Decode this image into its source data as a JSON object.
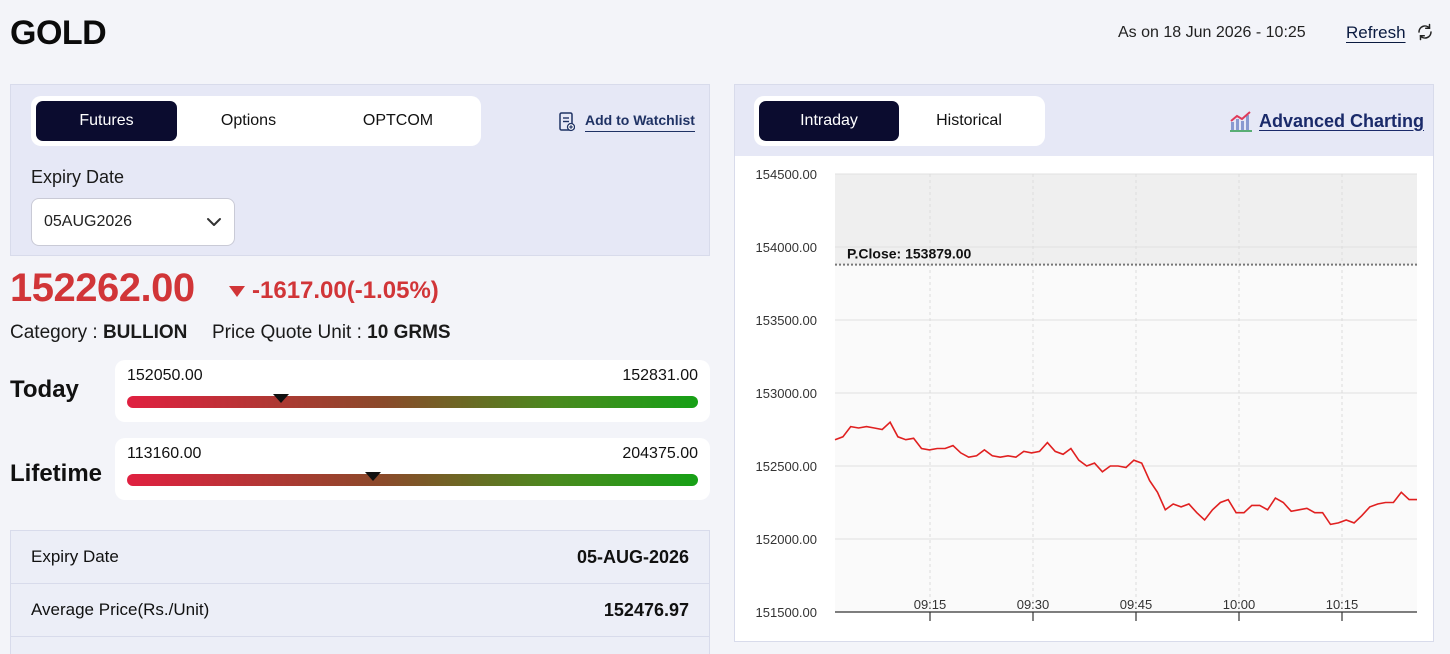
{
  "header": {
    "title": "GOLD",
    "as_on": "As on 18 Jun 2026 - 10:25",
    "refresh_label": "Refresh"
  },
  "left": {
    "tabs": [
      {
        "label": "Futures",
        "active": true
      },
      {
        "label": "Options",
        "active": false
      },
      {
        "label": "OPTCOM",
        "active": false
      }
    ],
    "watchlist_label": "Add to Watchlist",
    "expiry_label": "Expiry Date",
    "expiry_value": "05AUG2026",
    "price": "152262.00",
    "change": "-1617.00(-1.05%)",
    "category_label": "Category : ",
    "category_value": "BULLION",
    "pqu_label": "Price Quote Unit : ",
    "pqu_value": "10 GRMS",
    "today": {
      "label": "Today",
      "low": "152050.00",
      "high": "152831.00",
      "position": 0.27
    },
    "lifetime": {
      "label": "Lifetime",
      "low": "113160.00",
      "high": "204375.00",
      "position": 0.43
    },
    "info_rows": [
      {
        "label": "Expiry Date",
        "value": "05-AUG-2026"
      },
      {
        "label": "Average Price(Rs./Unit)",
        "value": "152476.97"
      }
    ]
  },
  "right": {
    "tabs": [
      {
        "label": "Intraday",
        "active": true
      },
      {
        "label": "Historical",
        "active": false
      }
    ],
    "advanced_label": "Advanced Charting"
  },
  "colors": {
    "accent_dark": "#0b0c2f",
    "negative": "#d13538",
    "series": "#e02020"
  },
  "chart_data": {
    "type": "line",
    "ylim": [
      151500,
      154500
    ],
    "yticks": [
      "154500.00",
      "154000.00",
      "153500.00",
      "153000.00",
      "152500.00",
      "152000.00",
      "151500.00"
    ],
    "xticks": [
      "09:15",
      "09:30",
      "09:45",
      "10:00",
      "10:15"
    ],
    "prev_close_label": "P.Close: 153879.00",
    "prev_close": 153879,
    "series": [
      {
        "values": [
          152680,
          152700,
          152770,
          152760,
          152770,
          152760,
          152750,
          152800,
          152700,
          152680,
          152690,
          152620,
          152610,
          152620,
          152620,
          152640,
          152590,
          152560,
          152570,
          152610,
          152570,
          152560,
          152570,
          152560,
          152600,
          152590,
          152600,
          152660,
          152600,
          152580,
          152620,
          152540,
          152500,
          152520,
          152460,
          152500,
          152500,
          152490,
          152540,
          152520,
          152400,
          152320,
          152200,
          152240,
          152220,
          152240,
          152180,
          152130,
          152200,
          152250,
          152270,
          152180,
          152180,
          152230,
          152230,
          152200,
          152280,
          152250,
          152190,
          152200,
          152210,
          152180,
          152180,
          152100,
          152110,
          152130,
          152110,
          152160,
          152220,
          152240,
          152250,
          152250,
          152320,
          152270,
          152270
        ]
      }
    ]
  }
}
